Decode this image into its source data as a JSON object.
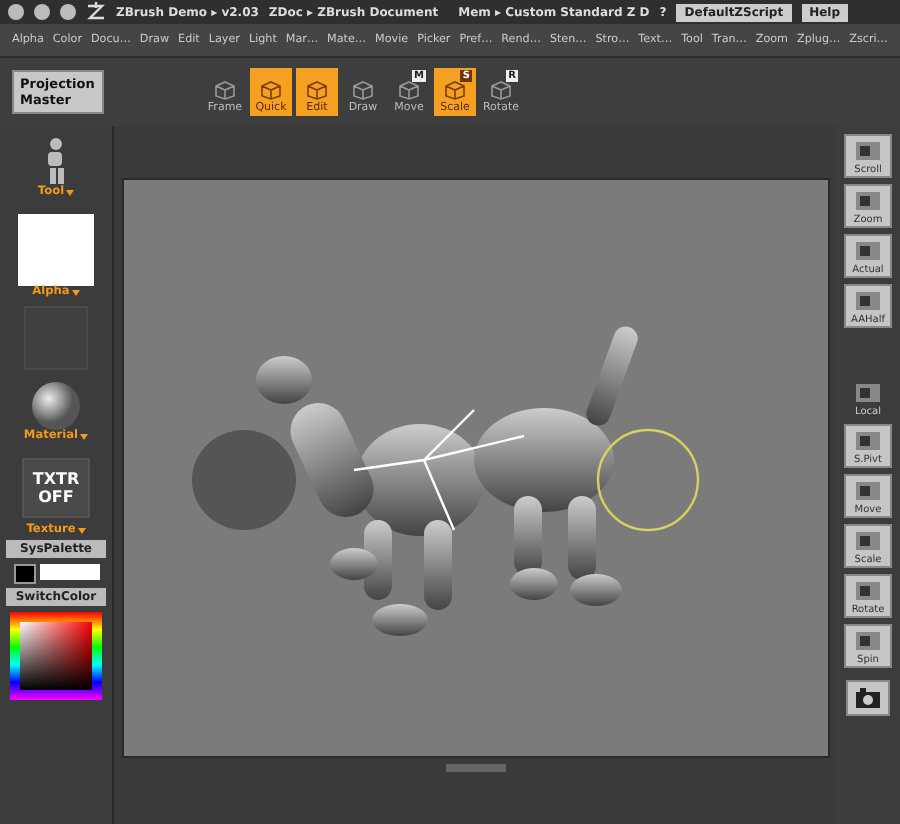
{
  "title_bar": {
    "app": "ZBrush Demo ▸ v2.03",
    "document": "ZDoc ▸ ZBrush Document",
    "memory": "Mem ▸ Custom Standard Z D",
    "help_mark": "?",
    "buttons": [
      "DefaultZScript",
      "Help"
    ]
  },
  "menu_bar": [
    "Alpha",
    "Color",
    "Docu…",
    "Draw",
    "Edit",
    "Layer",
    "Light",
    "Mar…",
    "Mate…",
    "Movie",
    "Picker",
    "Pref…",
    "Rend…",
    "Sten…",
    "Stro…",
    "Text…",
    "Tool",
    "Tran…",
    "Zoom",
    "Zplug…",
    "Zscri…"
  ],
  "projection_master": "Projection Master",
  "toolbar": [
    {
      "label": "Frame",
      "selected": false
    },
    {
      "label": "Quick",
      "selected": true
    },
    {
      "label": "Edit",
      "selected": true
    },
    {
      "label": "Draw",
      "selected": false
    },
    {
      "label": "Move",
      "badge": "M",
      "selected": false
    },
    {
      "label": "Scale",
      "badge": "S",
      "selected": true
    },
    {
      "label": "Rotate",
      "badge": "R",
      "selected": false
    }
  ],
  "left_panel": {
    "tool": "Tool",
    "alpha": "Alpha",
    "material": "Material",
    "texture_button": "TXTR OFF",
    "texture": "Texture",
    "palette_button": "SysPalette",
    "switch_button": "SwitchColor"
  },
  "right_panel": [
    {
      "kind": "button",
      "label": "Scroll"
    },
    {
      "kind": "button",
      "label": "Zoom"
    },
    {
      "kind": "button",
      "label": "Actual"
    },
    {
      "kind": "button",
      "label": "AAHalf"
    },
    {
      "kind": "plain",
      "label": "Local"
    },
    {
      "kind": "button",
      "label": "S.Pivt"
    },
    {
      "kind": "button",
      "label": "Move"
    },
    {
      "kind": "button",
      "label": "Scale"
    },
    {
      "kind": "button",
      "label": "Rotate"
    },
    {
      "kind": "button",
      "label": "Spin"
    },
    {
      "kind": "camera"
    }
  ]
}
